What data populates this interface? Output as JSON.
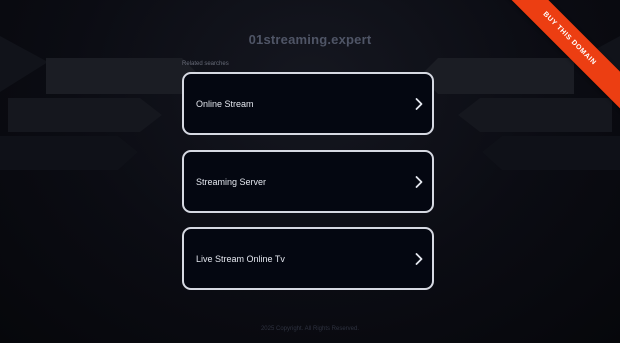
{
  "domain": "01streaming.expert",
  "ribbon": {
    "label": "BUY THIS DOMAIN",
    "color": "#ec3e12"
  },
  "related": {
    "label": "Related searches",
    "items": [
      {
        "label": "Online Stream",
        "icon": "chevron-right-icon"
      },
      {
        "label": "Streaming Server",
        "icon": "chevron-right-icon"
      },
      {
        "label": "Live Stream Online Tv",
        "icon": "chevron-right-icon"
      }
    ]
  },
  "footer": {
    "text": "2025 Copyright. All Rights Reserved."
  }
}
